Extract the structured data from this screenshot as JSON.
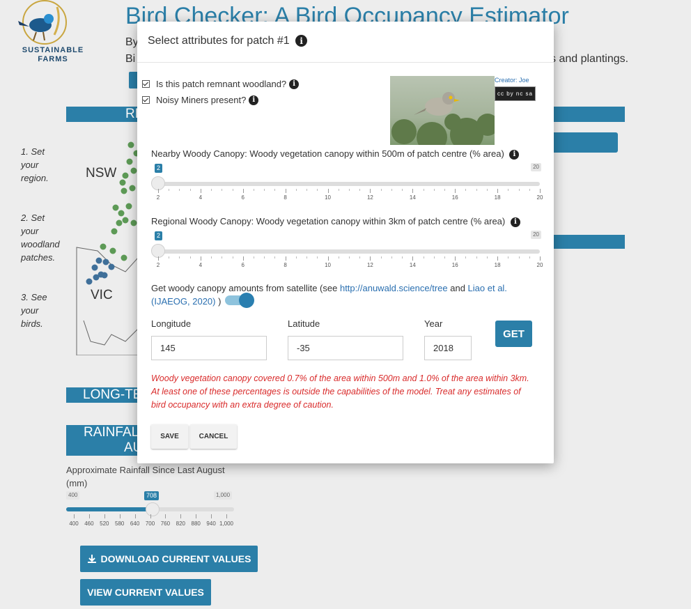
{
  "app": {
    "title": "Bird Checker: A Bird Occupancy Estimator",
    "byline": "By",
    "intro_start": "Bi",
    "intro_tail": "s and plantings.",
    "logo_line1": "SUSTAINABLE",
    "logo_line2": "FARMS"
  },
  "sections": {
    "region": "RE",
    "longterm": "LONG-TE",
    "rainfall_line1": "RAINFALL",
    "rainfall_line2": "AU"
  },
  "steps": [
    {
      "line1": "1. Set",
      "line2": "your",
      "line3": "region.",
      "line4": ""
    },
    {
      "line1": "2. Set",
      "line2": "your",
      "line3": "woodland",
      "line4": "patches."
    },
    {
      "line1": "3. See",
      "line2": "your",
      "line3": "birds.",
      "line4": ""
    }
  ],
  "map": {
    "nsw": "NSW",
    "vic": "VIC"
  },
  "rainfall": {
    "label": "Approximate Rainfall Since Last August (mm)",
    "min_label": "400",
    "max_label": "1,000",
    "value_label": "708",
    "min": 400,
    "max": 1000,
    "value": 708,
    "ticks": [
      "400",
      "460",
      "520",
      "580",
      "640",
      "700",
      "760",
      "820",
      "880",
      "940",
      "1,000"
    ]
  },
  "buttons": {
    "download": "DOWNLOAD CURRENT VALUES",
    "view": "VIEW CURRENT VALUES"
  },
  "modal": {
    "title": "Select attributes for patch #1",
    "remnant_label": "Is this patch remnant woodland?",
    "remnant_checked": true,
    "miners_label": "Noisy Miners present?",
    "miners_checked": true,
    "photo_credit": "Creator: Joe",
    "license_badge": "cc by nc sa",
    "nearby": {
      "label": "Nearby Woody Canopy: Woody vegetation canopy within 500m of patch centre (% area)",
      "min": 2,
      "max": 20,
      "value": 2,
      "value_label": "2",
      "max_label": "20",
      "ticks": [
        "2",
        "4",
        "6",
        "8",
        "10",
        "12",
        "14",
        "16",
        "18",
        "20"
      ]
    },
    "regional": {
      "label": "Regional Woody Canopy: Woody vegetation canopy within 3km of patch centre (% area)",
      "min": 2,
      "max": 20,
      "value": 2,
      "value_label": "2",
      "max_label": "20",
      "ticks": [
        "2",
        "4",
        "6",
        "8",
        "10",
        "12",
        "14",
        "16",
        "18",
        "20"
      ]
    },
    "satellite": {
      "text_start": "Get woody canopy amounts from satellite (see ",
      "link1": "http://anuwald.science/tree",
      "and": " and ",
      "link2": "Liao et al.",
      "link2b": "(IJAEOG, 2020)",
      "text_end": " )",
      "toggle_on": true
    },
    "longitude": {
      "label": "Longitude",
      "value": "145"
    },
    "latitude": {
      "label": "Latitude",
      "value": "-35"
    },
    "year": {
      "label": "Year",
      "value": "2018"
    },
    "get_label": "GET",
    "warning_line1": "Woody vegetation canopy covered 0.7% of the area within 500m and 1.0% of the area within 3km.",
    "warning_line2": "At least one of these percentages is outside the capabilities of the model. Treat any estimates of",
    "warning_line3": "bird occupancy with an extra degree of caution.",
    "save_label": "SAVE",
    "cancel_label": "CANCEL"
  },
  "colors": {
    "accent": "#2b7fa8",
    "warning": "#d92b2b",
    "link": "#2a6fb0"
  }
}
